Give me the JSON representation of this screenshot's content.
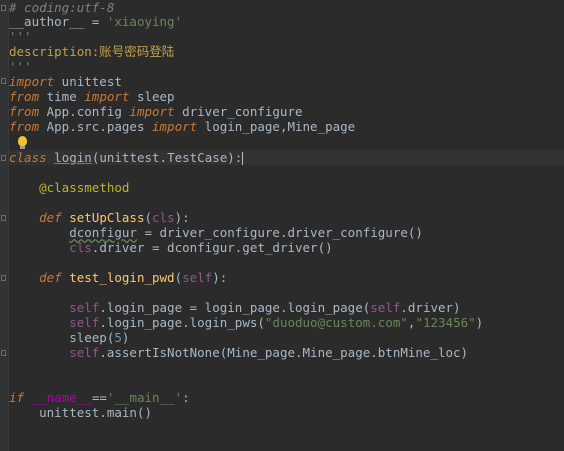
{
  "editor": {
    "lines": [
      {
        "segments": [
          [
            "comment",
            "# coding:utf-8"
          ]
        ]
      },
      {
        "segments": [
          [
            "plain",
            "__author__ = "
          ],
          [
            "str",
            "'xiaoying'"
          ]
        ]
      },
      {
        "segments": [
          [
            "doc",
            "'''"
          ]
        ]
      },
      {
        "segments": [
          [
            "docbody",
            "description:账号密码登陆"
          ]
        ]
      },
      {
        "segments": [
          [
            "doc",
            "'''"
          ]
        ]
      },
      {
        "segments": [
          [
            "kw",
            "import"
          ],
          [
            "plain",
            " unittest"
          ]
        ]
      },
      {
        "segments": [
          [
            "kw",
            "from"
          ],
          [
            "plain",
            " time "
          ],
          [
            "kw",
            "import"
          ],
          [
            "plain",
            " sleep"
          ]
        ]
      },
      {
        "segments": [
          [
            "kw",
            "from"
          ],
          [
            "plain",
            " App.config "
          ],
          [
            "kw",
            "import"
          ],
          [
            "plain",
            " driver_configure"
          ]
        ]
      },
      {
        "segments": [
          [
            "kw",
            "from"
          ],
          [
            "plain",
            " App.src.pages "
          ],
          [
            "kw",
            "import"
          ],
          [
            "plain",
            " login_page,Mine_page"
          ]
        ]
      },
      {
        "segments": []
      },
      {
        "segments": [
          [
            "kw",
            "class"
          ],
          [
            "plain",
            " "
          ],
          [
            "ul",
            "login"
          ],
          [
            "plain",
            "(unittest.TestCase):"
          ]
        ]
      },
      {
        "segments": []
      },
      {
        "segments": [
          [
            "plain",
            "    "
          ],
          [
            "deco",
            "@classmethod"
          ]
        ]
      },
      {
        "segments": []
      },
      {
        "segments": [
          [
            "plain",
            "    "
          ],
          [
            "kw",
            "def"
          ],
          [
            "plain",
            " "
          ],
          [
            "fn",
            "setUpClass"
          ],
          [
            "plain",
            "("
          ],
          [
            "self",
            "cls"
          ],
          [
            "plain",
            "):"
          ]
        ]
      },
      {
        "segments": [
          [
            "plain",
            "        "
          ],
          [
            "wavy",
            "dconfigur"
          ],
          [
            "plain",
            " = driver_configure.driver_configure()"
          ]
        ]
      },
      {
        "segments": [
          [
            "plain",
            "        "
          ],
          [
            "self",
            "cls"
          ],
          [
            "plain",
            ".driver = dconfigur.get_driver()"
          ]
        ]
      },
      {
        "segments": []
      },
      {
        "segments": [
          [
            "plain",
            "    "
          ],
          [
            "kw",
            "def"
          ],
          [
            "plain",
            " "
          ],
          [
            "fn",
            "test_login_pwd"
          ],
          [
            "plain",
            "("
          ],
          [
            "self",
            "self"
          ],
          [
            "plain",
            "):"
          ]
        ]
      },
      {
        "segments": []
      },
      {
        "segments": [
          [
            "plain",
            "        "
          ],
          [
            "self",
            "self"
          ],
          [
            "plain",
            ".login_page = login_page.login_page("
          ],
          [
            "self",
            "self"
          ],
          [
            "plain",
            ".driver)"
          ]
        ]
      },
      {
        "segments": [
          [
            "plain",
            "        "
          ],
          [
            "self",
            "self"
          ],
          [
            "plain",
            ".login_page.login_pws("
          ],
          [
            "str",
            "\"duoduo@custom.com\""
          ],
          [
            "plain",
            ","
          ],
          [
            "str",
            "\"123456\""
          ],
          [
            "plain",
            ")"
          ]
        ]
      },
      {
        "segments": [
          [
            "plain",
            "        sleep("
          ],
          [
            "num",
            "5"
          ],
          [
            "plain",
            ")"
          ]
        ]
      },
      {
        "segments": [
          [
            "plain",
            "        "
          ],
          [
            "self",
            "self"
          ],
          [
            "plain",
            ".assertIsNotNone(Mine_page.Mine_page.btnMine_loc)"
          ]
        ]
      },
      {
        "segments": []
      },
      {
        "segments": []
      },
      {
        "segments": [
          [
            "kw",
            "if"
          ],
          [
            "plain",
            " "
          ],
          [
            "dunder",
            "__name__"
          ],
          [
            "plain",
            "=="
          ],
          [
            "str",
            "'__main__'"
          ],
          [
            "plain",
            ":"
          ]
        ]
      },
      {
        "segments": [
          [
            "plain",
            "    unittest.main()"
          ]
        ]
      }
    ]
  }
}
